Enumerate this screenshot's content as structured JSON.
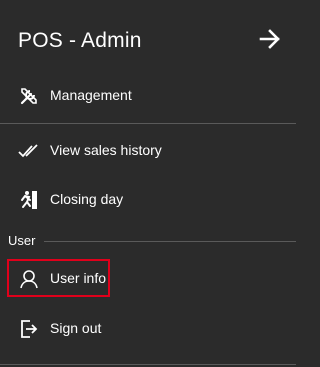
{
  "header": {
    "title": "POS - Admin",
    "collapse_icon": "arrow-right-icon"
  },
  "nav": {
    "management": {
      "label": "Management",
      "icon": "tools-icon"
    },
    "sales_history": {
      "label": "View sales history",
      "icon": "double-check-icon"
    },
    "closing_day": {
      "label": "Closing day",
      "icon": "exit-running-icon"
    }
  },
  "user_section": {
    "label": "User",
    "user_info": {
      "label": "User info",
      "icon": "person-icon",
      "highlighted": true
    },
    "sign_out": {
      "label": "Sign out",
      "icon": "sign-out-icon"
    }
  },
  "colors": {
    "background": "#2b2b2b",
    "text": "#ffffff",
    "divider": "#5a5a5a",
    "highlight": "#e0001b"
  }
}
